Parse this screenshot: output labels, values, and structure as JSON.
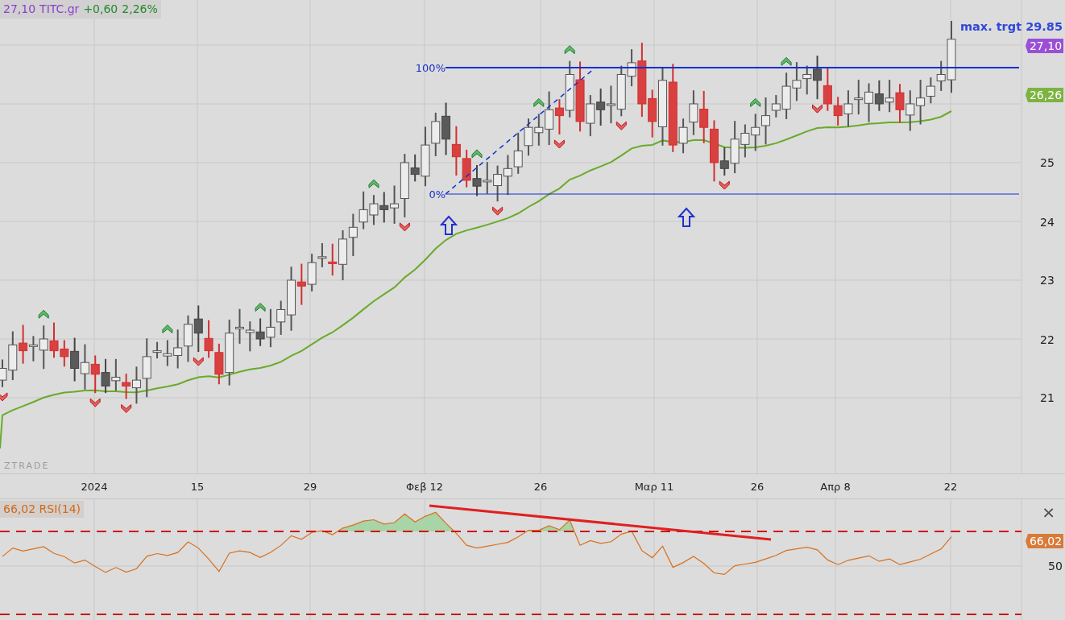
{
  "header": {
    "price": "27,10",
    "symbol": "TITC.gr",
    "change": "+0,60",
    "change_pct": "2,26%"
  },
  "price_chart": {
    "watermark": "ZTRADE",
    "target_label": "max. trgt 29.85",
    "fib_levels": [
      {
        "label": "100%"
      },
      {
        "label": "0%"
      }
    ],
    "price_axis": [
      "25",
      "24",
      "23",
      "22",
      "21"
    ],
    "last_price_tag": "27,10",
    "ma_tag": "26,26"
  },
  "time_axis": [
    "2024",
    "15",
    "29",
    "Φεβ 12",
    "26",
    "Μαρ 11",
    "26",
    "Απρ 8",
    "22"
  ],
  "rsi_pane": {
    "value": "66,02",
    "title": "RSI(14)",
    "value_tag": "66,02",
    "axis": [
      "50"
    ],
    "close": "×"
  }
}
